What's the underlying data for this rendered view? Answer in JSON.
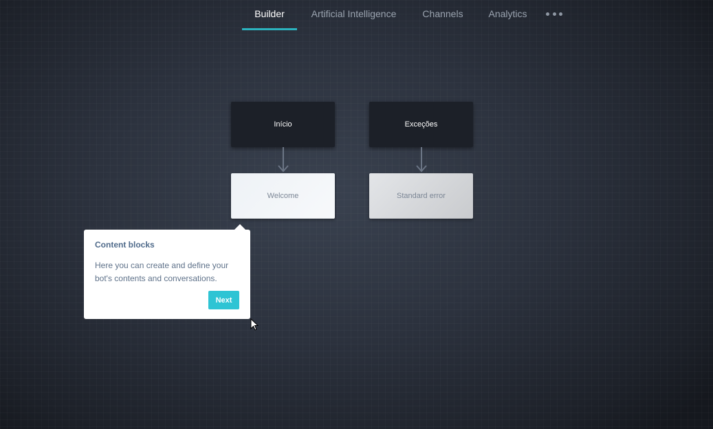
{
  "nav": {
    "tabs": [
      {
        "label": "Builder",
        "active": true
      },
      {
        "label": "Artificial Intelligence",
        "active": false
      },
      {
        "label": "Channels",
        "active": false
      },
      {
        "label": "Analytics",
        "active": false
      }
    ],
    "more_icon": "more-horizontal-icon"
  },
  "canvas": {
    "blocks": [
      {
        "label": "Início",
        "style": "dark"
      },
      {
        "label": "Exceções",
        "style": "dark"
      },
      {
        "label": "Welcome",
        "style": "light"
      },
      {
        "label": "Standard error",
        "style": "light"
      }
    ]
  },
  "tooltip": {
    "title": "Content blocks",
    "body": "Here you can create and define your bot's contents and conversations.",
    "next_label": "Next"
  },
  "colors": {
    "accent": "#2bb3bf",
    "button": "#2ec4d4",
    "block_dark": "#1c2028"
  }
}
